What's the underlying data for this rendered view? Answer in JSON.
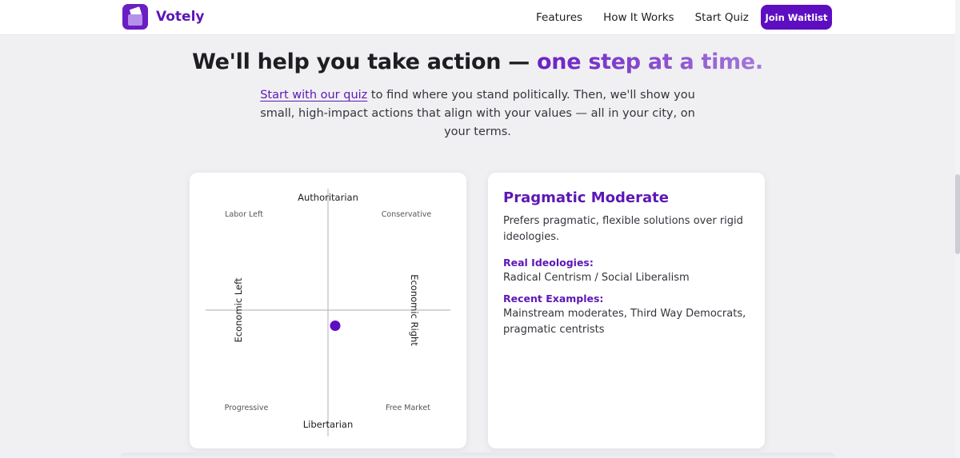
{
  "header": {
    "brand": "Votely",
    "nav": [
      "Features",
      "How It Works",
      "Start Quiz"
    ],
    "cta": "Join Waitlist"
  },
  "hero": {
    "headline_plain": "We'll help you take action — ",
    "headline_accent": "one step at a time.",
    "sub_link": "Start with our quiz",
    "sub_rest": " to find where you stand politically. Then, we'll show you small, high-impact actions that align with your values — all in your city, on your terms."
  },
  "compass": {
    "top": "Authoritarian",
    "bottom": "Libertarian",
    "left": "Economic Left",
    "right": "Economic Right",
    "quadrants": {
      "top_left": "Labor Left",
      "top_right": "Conservative",
      "bottom_left": "Progressive",
      "bottom_right": "Free Market"
    },
    "user_position": {
      "economic": 0.06,
      "social": -0.13
    }
  },
  "result": {
    "title": "Pragmatic Moderate",
    "description": "Prefers pragmatic, flexible solutions over rigid ideologies.",
    "ideologies_heading": "Real Ideologies:",
    "ideologies": "Radical Centrism / Social Liberalism",
    "examples_heading": "Recent Examples:",
    "examples": "Mainstream moderates, Third Way Democrats, pragmatic centrists"
  },
  "colors": {
    "brand": "#5d17b5",
    "accent_gradient_end": "#a57ad8",
    "dot": "#5d0ec1"
  }
}
